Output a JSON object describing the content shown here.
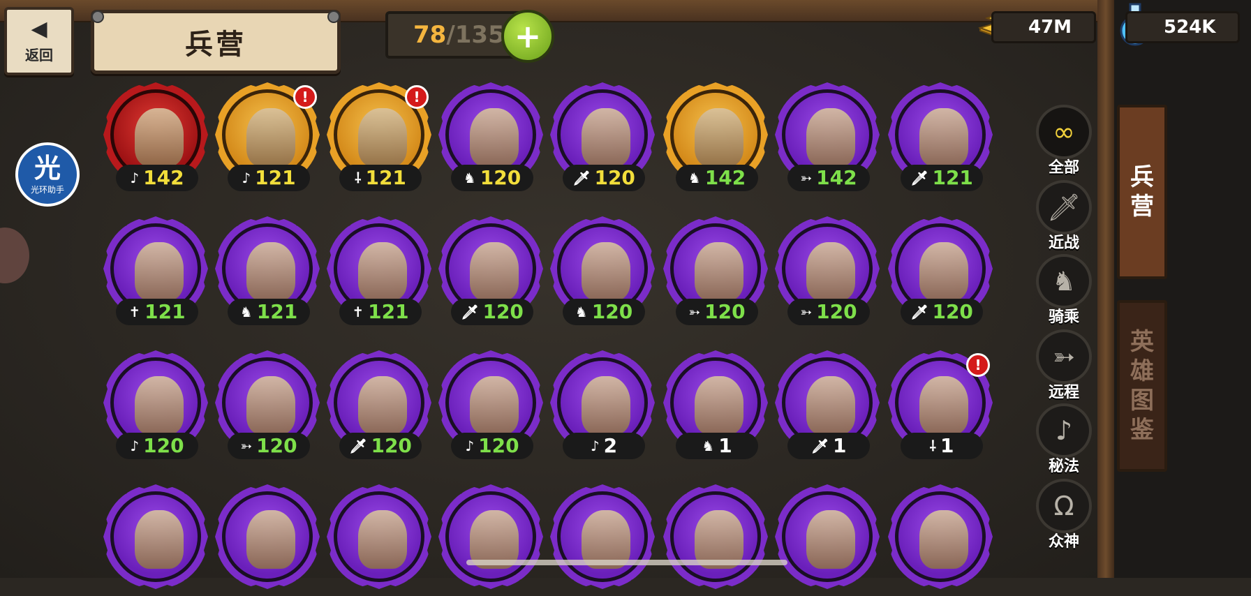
{
  "header": {
    "back_label": "返回",
    "back_arrow": "◀",
    "title": "兵营",
    "capacity_current": "78",
    "capacity_sep": "/",
    "capacity_max": "135",
    "add_label": "+"
  },
  "resources": {
    "gold": "47M",
    "potion": "524K"
  },
  "assistant": {
    "badge": "光",
    "label": "光环助手"
  },
  "filters": [
    {
      "label": "全部",
      "icon": "∞",
      "name": "filter-all"
    },
    {
      "label": "近战",
      "icon": "🗡",
      "name": "filter-melee"
    },
    {
      "label": "骑乘",
      "icon": "♞",
      "name": "filter-mounted"
    },
    {
      "label": "远程",
      "icon": "➳",
      "name": "filter-ranged"
    },
    {
      "label": "秘法",
      "icon": "♪",
      "name": "filter-arcane"
    },
    {
      "label": "众神",
      "icon": "Ω",
      "name": "filter-gods"
    }
  ],
  "side_tabs": [
    {
      "label": "兵营",
      "name": "tab-barracks"
    },
    {
      "label": "英雄图鉴",
      "name": "tab-hero-codex"
    }
  ],
  "colors": {
    "level_yellow": "#f2de3b",
    "level_green": "#7ee04a",
    "frame_purple": "#7b2cc9",
    "frame_gold": "#e9a126",
    "frame_red": "#b8191c"
  },
  "units": [
    {
      "frame": "red",
      "class": "arcane",
      "icon": "♪",
      "level": "142",
      "level_color": "yellow",
      "alert": false
    },
    {
      "frame": "gold",
      "class": "arcane",
      "icon": "♪",
      "level": "121",
      "level_color": "yellow",
      "alert": true
    },
    {
      "frame": "gold",
      "class": "spear",
      "icon": "⸸",
      "level": "121",
      "level_color": "yellow",
      "alert": true
    },
    {
      "frame": "purple",
      "class": "mounted-ranged",
      "icon": "♞",
      "level": "120",
      "level_color": "yellow",
      "alert": false
    },
    {
      "frame": "purple",
      "class": "melee",
      "icon": "🗡",
      "level": "120",
      "level_color": "yellow",
      "alert": false
    },
    {
      "frame": "gold",
      "class": "mounted",
      "icon": "♞",
      "level": "142",
      "level_color": "green",
      "alert": false
    },
    {
      "frame": "purple",
      "class": "ranged",
      "icon": "➳",
      "level": "142",
      "level_color": "green",
      "alert": false
    },
    {
      "frame": "purple",
      "class": "melee",
      "icon": "🗡",
      "level": "121",
      "level_color": "green",
      "alert": false
    },
    {
      "frame": "purple",
      "class": "holy",
      "icon": "✝",
      "level": "121",
      "level_color": "green",
      "alert": false
    },
    {
      "frame": "purple",
      "class": "mounted",
      "icon": "♞",
      "level": "121",
      "level_color": "green",
      "alert": false
    },
    {
      "frame": "purple",
      "class": "holy",
      "icon": "✝",
      "level": "121",
      "level_color": "green",
      "alert": false
    },
    {
      "frame": "purple",
      "class": "melee",
      "icon": "🗡",
      "level": "120",
      "level_color": "green",
      "alert": false
    },
    {
      "frame": "purple",
      "class": "mounted",
      "icon": "♞",
      "level": "120",
      "level_color": "green",
      "alert": false
    },
    {
      "frame": "purple",
      "class": "ranged",
      "icon": "➳",
      "level": "120",
      "level_color": "green",
      "alert": false
    },
    {
      "frame": "purple",
      "class": "ranged",
      "icon": "➳",
      "level": "120",
      "level_color": "green",
      "alert": false
    },
    {
      "frame": "purple",
      "class": "melee",
      "icon": "🗡",
      "level": "120",
      "level_color": "green",
      "alert": false
    },
    {
      "frame": "purple",
      "class": "arcane",
      "icon": "♪",
      "level": "120",
      "level_color": "green",
      "alert": false
    },
    {
      "frame": "purple",
      "class": "ranged",
      "icon": "➳",
      "level": "120",
      "level_color": "green",
      "alert": false
    },
    {
      "frame": "purple",
      "class": "melee",
      "icon": "🗡",
      "level": "120",
      "level_color": "green",
      "alert": false
    },
    {
      "frame": "purple",
      "class": "arcane",
      "icon": "♪",
      "level": "120",
      "level_color": "green",
      "alert": false
    },
    {
      "frame": "purple",
      "class": "arcane",
      "icon": "♪",
      "level": "2",
      "level_color": "white",
      "alert": false
    },
    {
      "frame": "purple",
      "class": "mounted-ranged",
      "icon": "♞",
      "level": "1",
      "level_color": "white",
      "alert": false
    },
    {
      "frame": "purple",
      "class": "melee",
      "icon": "🗡",
      "level": "1",
      "level_color": "white",
      "alert": false
    },
    {
      "frame": "purple",
      "class": "spear",
      "icon": "⸸",
      "level": "1",
      "level_color": "white",
      "alert": true
    },
    {
      "frame": "purple",
      "class": "",
      "icon": "",
      "level": "",
      "level_color": "white",
      "alert": false
    },
    {
      "frame": "purple",
      "class": "",
      "icon": "",
      "level": "",
      "level_color": "white",
      "alert": false
    },
    {
      "frame": "purple",
      "class": "",
      "icon": "",
      "level": "",
      "level_color": "white",
      "alert": false
    },
    {
      "frame": "purple",
      "class": "",
      "icon": "",
      "level": "",
      "level_color": "white",
      "alert": false
    },
    {
      "frame": "purple",
      "class": "",
      "icon": "",
      "level": "",
      "level_color": "white",
      "alert": false
    },
    {
      "frame": "purple",
      "class": "",
      "icon": "",
      "level": "",
      "level_color": "white",
      "alert": false
    },
    {
      "frame": "purple",
      "class": "",
      "icon": "",
      "level": "",
      "level_color": "white",
      "alert": false
    },
    {
      "frame": "purple",
      "class": "",
      "icon": "",
      "level": "",
      "level_color": "white",
      "alert": false
    }
  ]
}
